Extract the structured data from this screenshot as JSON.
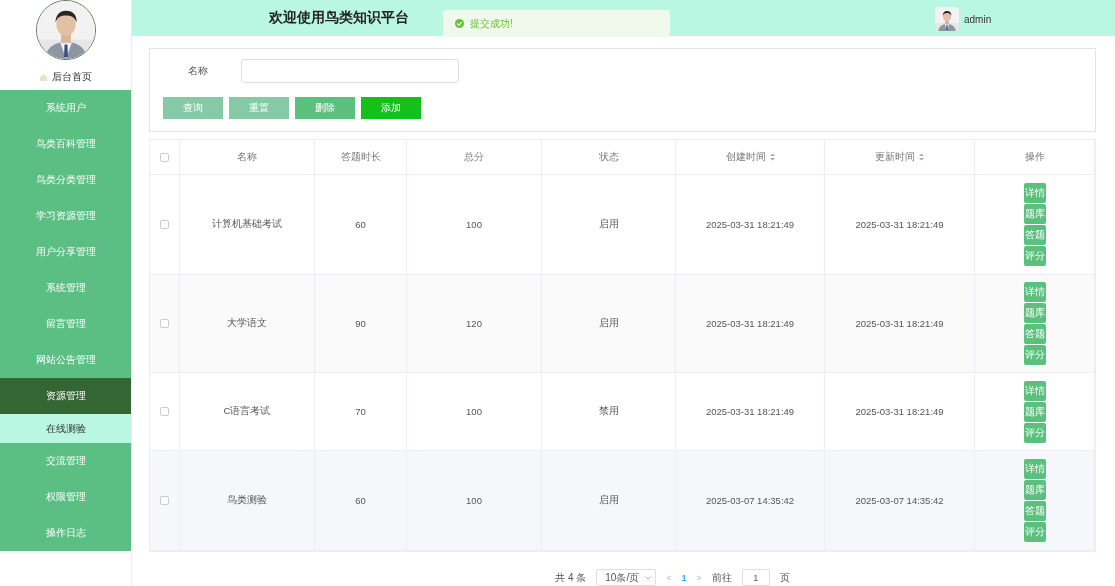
{
  "sidebar": {
    "home": "后台首页",
    "items": [
      {
        "label": "系统用户",
        "selected": false
      },
      {
        "label": "鸟类百科管理",
        "selected": false
      },
      {
        "label": "鸟类分类管理",
        "selected": false
      },
      {
        "label": "学习资源管理",
        "selected": false
      },
      {
        "label": "用户分享管理",
        "selected": false
      },
      {
        "label": "系统管理",
        "selected": false
      },
      {
        "label": "留言管理",
        "selected": false
      },
      {
        "label": "网站公告管理",
        "selected": false
      },
      {
        "label": "资源管理",
        "selected": true,
        "children": [
          {
            "label": "在线测验",
            "selected": true
          }
        ]
      },
      {
        "label": "交流管理",
        "selected": false
      },
      {
        "label": "权限管理",
        "selected": false
      },
      {
        "label": "操作日志",
        "selected": false
      }
    ]
  },
  "header": {
    "title": "欢迎使用鸟类知识平台",
    "toast": "提交成功!",
    "user": "admin"
  },
  "search": {
    "label": "名称",
    "buttons": [
      {
        "label": "查询",
        "kind": "light"
      },
      {
        "label": "重置",
        "kind": "light"
      },
      {
        "label": "删除",
        "kind": "medium"
      },
      {
        "label": "添加",
        "kind": "strong"
      }
    ]
  },
  "table": {
    "all_checked": false,
    "columns": [
      {
        "label": "名称",
        "sortable": false
      },
      {
        "label": "答题时长",
        "sortable": false
      },
      {
        "label": "总分",
        "sortable": false
      },
      {
        "label": "状态",
        "sortable": false
      },
      {
        "label": "创建时间",
        "sortable": true
      },
      {
        "label": "更新时间",
        "sortable": true
      },
      {
        "label": "操作",
        "sortable": false
      }
    ],
    "rows": [
      {
        "checked": false,
        "cells": [
          "计算机基础考试",
          "60",
          "100",
          "启用",
          "2025-03-31 18:21:49",
          "2025-03-31 18:21:49"
        ],
        "actions": [
          "详情",
          "题库",
          "答题",
          "评分"
        ]
      },
      {
        "checked": false,
        "cells": [
          "大学语文",
          "90",
          "120",
          "启用",
          "2025-03-31 18:21:49",
          "2025-03-31 18:21:49"
        ],
        "actions": [
          "详情",
          "题库",
          "答题",
          "评分"
        ]
      },
      {
        "checked": false,
        "cells": [
          "C语言考试",
          "70",
          "100",
          "禁用",
          "2025-03-31 18:21:49",
          "2025-03-31 18:21:49"
        ],
        "actions": [
          "详情",
          "题库",
          "评分"
        ]
      },
      {
        "checked": false,
        "cells": [
          "鸟类测验",
          "60",
          "100",
          "启用",
          "2025-03-07 14:35:42",
          "2025-03-07 14:35:42"
        ],
        "actions": [
          "详情",
          "题库",
          "答题",
          "评分"
        ]
      }
    ]
  },
  "pagination": {
    "total": "共 4 条",
    "page_size": "10条/页",
    "prev": "<",
    "pages": [
      {
        "label": "1",
        "selected": true
      }
    ],
    "next": ">",
    "goto_label": "前往",
    "goto_value": "1",
    "goto_suffix": "页"
  }
}
